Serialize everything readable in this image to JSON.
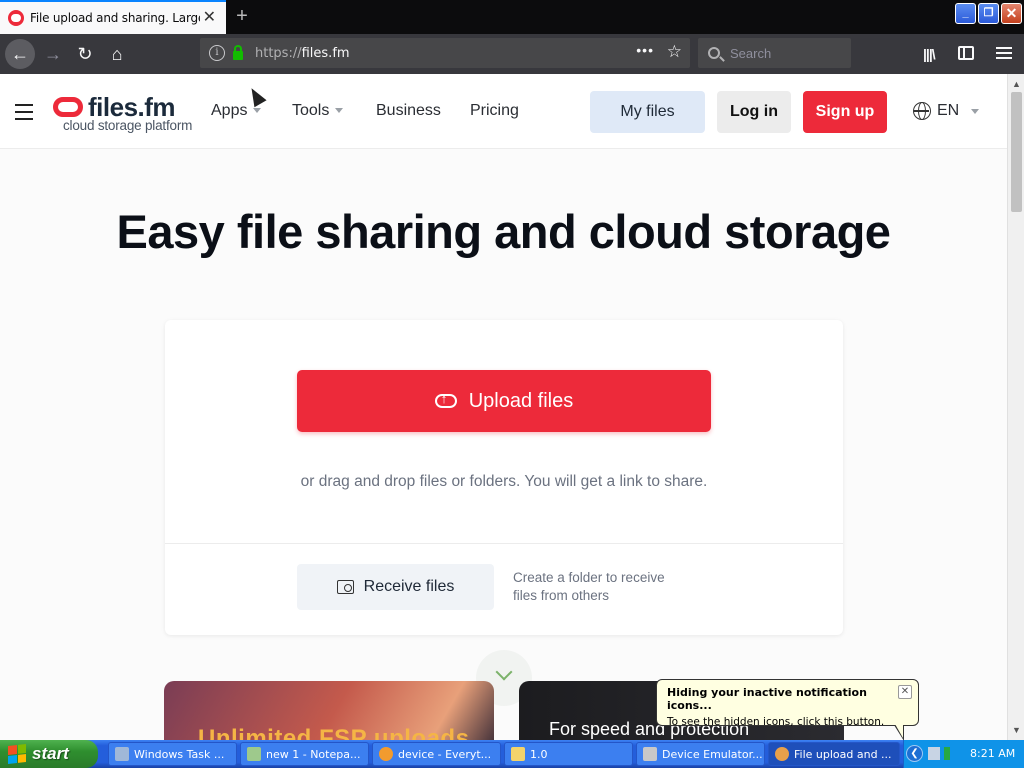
{
  "browser": {
    "tab_title": "File upload and sharing. Large file",
    "tab_close": "✕",
    "new_tab": "+",
    "window_buttons": {
      "minimize": "_",
      "maximize": "❐",
      "close": "✕"
    },
    "url_protocol": "https://",
    "url_host": "files.fm",
    "url_actions": "•••",
    "bookmark_star": "☆",
    "search_placeholder": "Search",
    "library_icon": "|||\\"
  },
  "site": {
    "logo_text": "files.fm",
    "logo_tagline": "cloud storage platform",
    "nav": [
      {
        "label": "Apps",
        "has_dropdown": true
      },
      {
        "label": "Tools",
        "has_dropdown": true
      },
      {
        "label": "Business",
        "has_dropdown": false
      },
      {
        "label": "Pricing",
        "has_dropdown": false
      }
    ],
    "my_files": "My files",
    "login": "Log in",
    "signup": "Sign up",
    "language": "EN",
    "hero_title": "Easy file sharing and cloud storage",
    "upload_button": "Upload files",
    "drag_hint": "or drag and drop files or folders. You will get a link to share.",
    "receive_button": "Receive files",
    "receive_hint": "Create a folder to receive files from others",
    "promo_left": "Unlimited FSP uploads",
    "promo_right": "For speed and protection",
    "accent_color": "#ed2a3a"
  },
  "notification": {
    "title": "Hiding your inactive notification icons...",
    "body": "To see the hidden icons, click this button.",
    "close": "✕"
  },
  "taskbar": {
    "start_label": "start",
    "tasks": [
      {
        "label": "Windows Task ...",
        "icon_color": "#a0b8d8"
      },
      {
        "label": "new 1 - Notepa...",
        "icon_color": "#9ec98c"
      },
      {
        "label": "device - Everyt...",
        "icon_color": "#f29b2e"
      },
      {
        "label": "1.0",
        "icon_color": "#f3d36b"
      },
      {
        "label": "Device Emulator...",
        "icon_color": "#c8c8c8"
      },
      {
        "label": "File upload and ...",
        "icon_color": "#e8a04a"
      }
    ],
    "tray_chevron": "❮",
    "clock": "8:21 AM"
  }
}
